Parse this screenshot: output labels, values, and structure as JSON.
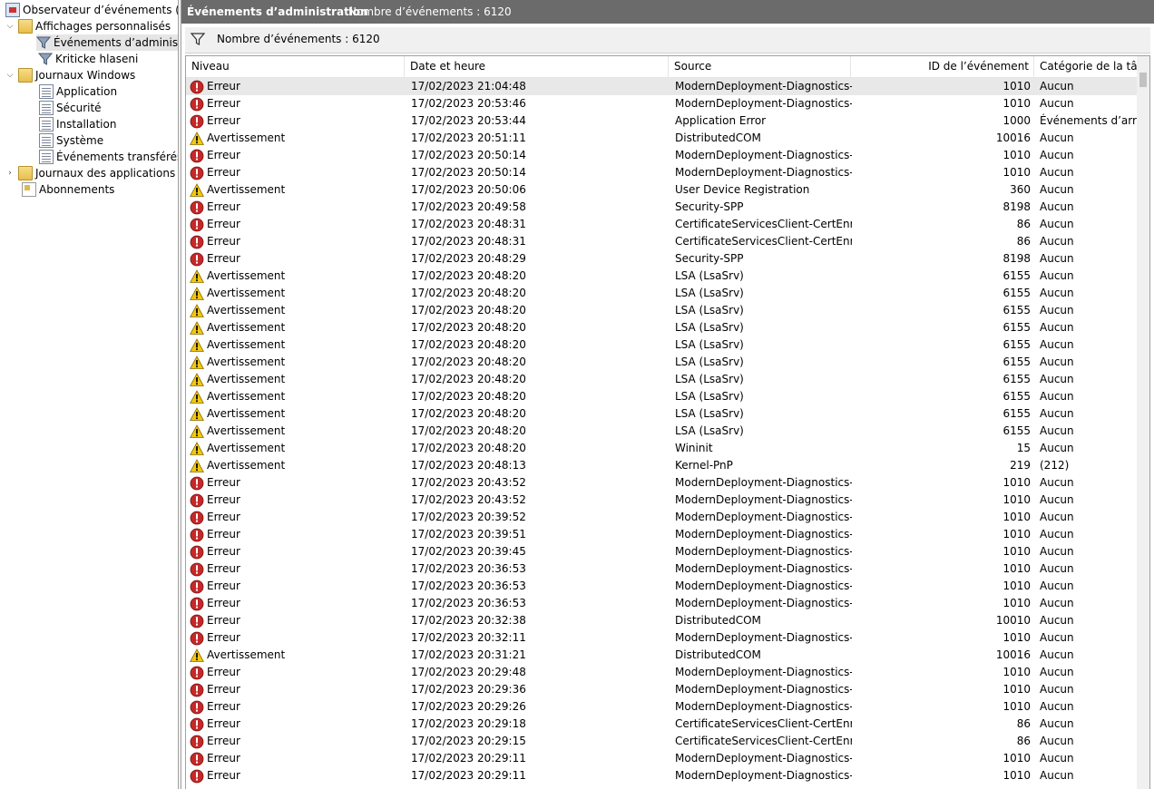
{
  "tree": {
    "root": "Observateur d’événements (Local)",
    "custom_views": "Affichages personnalisés",
    "admin_events": "Événements d’administration",
    "critical_errors": "Kriticke hlaseni",
    "windows_logs": "Journaux Windows",
    "application": "Application",
    "security": "Sécurité",
    "setup": "Installation",
    "system": "Système",
    "forwarded": "Événements transférés",
    "apps_services": "Journaux des applications et des services",
    "subscriptions": "Abonnements"
  },
  "titlebar": {
    "title": "Événements d’administration",
    "count": "Nombre d’événements : 6120"
  },
  "filter": {
    "text": "Nombre d’événements : 6120"
  },
  "columns": {
    "level": "Niveau",
    "datetime": "Date et heure",
    "source": "Source",
    "event_id": "ID de l’événement",
    "category": "Catégorie de la tâche"
  },
  "colors": {
    "error": "#c62828",
    "warning": "#f2c811",
    "titlebar": "#6b6b6b"
  },
  "events": [
    {
      "level": "Erreur",
      "type": "error",
      "datetime": "17/02/2023 21:04:48",
      "source": "ModernDeployment-Diagnostics-...",
      "id": "1010",
      "category": "Aucun"
    },
    {
      "level": "Erreur",
      "type": "error",
      "datetime": "17/02/2023 20:53:46",
      "source": "ModernDeployment-Diagnostics-...",
      "id": "1010",
      "category": "Aucun"
    },
    {
      "level": "Erreur",
      "type": "error",
      "datetime": "17/02/2023 20:53:44",
      "source": "Application Error",
      "id": "1000",
      "category": "Événements d’arrêts"
    },
    {
      "level": "Avertissement",
      "type": "warning",
      "datetime": "17/02/2023 20:51:11",
      "source": "DistributedCOM",
      "id": "10016",
      "category": "Aucun"
    },
    {
      "level": "Erreur",
      "type": "error",
      "datetime": "17/02/2023 20:50:14",
      "source": "ModernDeployment-Diagnostics-...",
      "id": "1010",
      "category": "Aucun"
    },
    {
      "level": "Erreur",
      "type": "error",
      "datetime": "17/02/2023 20:50:14",
      "source": "ModernDeployment-Diagnostics-...",
      "id": "1010",
      "category": "Aucun"
    },
    {
      "level": "Avertissement",
      "type": "warning",
      "datetime": "17/02/2023 20:50:06",
      "source": "User Device Registration",
      "id": "360",
      "category": "Aucun"
    },
    {
      "level": "Erreur",
      "type": "error",
      "datetime": "17/02/2023 20:49:58",
      "source": "Security-SPP",
      "id": "8198",
      "category": "Aucun"
    },
    {
      "level": "Erreur",
      "type": "error",
      "datetime": "17/02/2023 20:48:31",
      "source": "CertificateServicesClient-CertEnroll",
      "id": "86",
      "category": "Aucun"
    },
    {
      "level": "Erreur",
      "type": "error",
      "datetime": "17/02/2023 20:48:31",
      "source": "CertificateServicesClient-CertEnroll",
      "id": "86",
      "category": "Aucun"
    },
    {
      "level": "Erreur",
      "type": "error",
      "datetime": "17/02/2023 20:48:29",
      "source": "Security-SPP",
      "id": "8198",
      "category": "Aucun"
    },
    {
      "level": "Avertissement",
      "type": "warning",
      "datetime": "17/02/2023 20:48:20",
      "source": "LSA (LsaSrv)",
      "id": "6155",
      "category": "Aucun"
    },
    {
      "level": "Avertissement",
      "type": "warning",
      "datetime": "17/02/2023 20:48:20",
      "source": "LSA (LsaSrv)",
      "id": "6155",
      "category": "Aucun"
    },
    {
      "level": "Avertissement",
      "type": "warning",
      "datetime": "17/02/2023 20:48:20",
      "source": "LSA (LsaSrv)",
      "id": "6155",
      "category": "Aucun"
    },
    {
      "level": "Avertissement",
      "type": "warning",
      "datetime": "17/02/2023 20:48:20",
      "source": "LSA (LsaSrv)",
      "id": "6155",
      "category": "Aucun"
    },
    {
      "level": "Avertissement",
      "type": "warning",
      "datetime": "17/02/2023 20:48:20",
      "source": "LSA (LsaSrv)",
      "id": "6155",
      "category": "Aucun"
    },
    {
      "level": "Avertissement",
      "type": "warning",
      "datetime": "17/02/2023 20:48:20",
      "source": "LSA (LsaSrv)",
      "id": "6155",
      "category": "Aucun"
    },
    {
      "level": "Avertissement",
      "type": "warning",
      "datetime": "17/02/2023 20:48:20",
      "source": "LSA (LsaSrv)",
      "id": "6155",
      "category": "Aucun"
    },
    {
      "level": "Avertissement",
      "type": "warning",
      "datetime": "17/02/2023 20:48:20",
      "source": "LSA (LsaSrv)",
      "id": "6155",
      "category": "Aucun"
    },
    {
      "level": "Avertissement",
      "type": "warning",
      "datetime": "17/02/2023 20:48:20",
      "source": "LSA (LsaSrv)",
      "id": "6155",
      "category": "Aucun"
    },
    {
      "level": "Avertissement",
      "type": "warning",
      "datetime": "17/02/2023 20:48:20",
      "source": "LSA (LsaSrv)",
      "id": "6155",
      "category": "Aucun"
    },
    {
      "level": "Avertissement",
      "type": "warning",
      "datetime": "17/02/2023 20:48:20",
      "source": "Wininit",
      "id": "15",
      "category": "Aucun"
    },
    {
      "level": "Avertissement",
      "type": "warning",
      "datetime": "17/02/2023 20:48:13",
      "source": "Kernel-PnP",
      "id": "219",
      "category": "(212)"
    },
    {
      "level": "Erreur",
      "type": "error",
      "datetime": "17/02/2023 20:43:52",
      "source": "ModernDeployment-Diagnostics-...",
      "id": "1010",
      "category": "Aucun"
    },
    {
      "level": "Erreur",
      "type": "error",
      "datetime": "17/02/2023 20:43:52",
      "source": "ModernDeployment-Diagnostics-...",
      "id": "1010",
      "category": "Aucun"
    },
    {
      "level": "Erreur",
      "type": "error",
      "datetime": "17/02/2023 20:39:52",
      "source": "ModernDeployment-Diagnostics-...",
      "id": "1010",
      "category": "Aucun"
    },
    {
      "level": "Erreur",
      "type": "error",
      "datetime": "17/02/2023 20:39:51",
      "source": "ModernDeployment-Diagnostics-...",
      "id": "1010",
      "category": "Aucun"
    },
    {
      "level": "Erreur",
      "type": "error",
      "datetime": "17/02/2023 20:39:45",
      "source": "ModernDeployment-Diagnostics-...",
      "id": "1010",
      "category": "Aucun"
    },
    {
      "level": "Erreur",
      "type": "error",
      "datetime": "17/02/2023 20:36:53",
      "source": "ModernDeployment-Diagnostics-...",
      "id": "1010",
      "category": "Aucun"
    },
    {
      "level": "Erreur",
      "type": "error",
      "datetime": "17/02/2023 20:36:53",
      "source": "ModernDeployment-Diagnostics-...",
      "id": "1010",
      "category": "Aucun"
    },
    {
      "level": "Erreur",
      "type": "error",
      "datetime": "17/02/2023 20:36:53",
      "source": "ModernDeployment-Diagnostics-...",
      "id": "1010",
      "category": "Aucun"
    },
    {
      "level": "Erreur",
      "type": "error",
      "datetime": "17/02/2023 20:32:38",
      "source": "DistributedCOM",
      "id": "10010",
      "category": "Aucun"
    },
    {
      "level": "Erreur",
      "type": "error",
      "datetime": "17/02/2023 20:32:11",
      "source": "ModernDeployment-Diagnostics-...",
      "id": "1010",
      "category": "Aucun"
    },
    {
      "level": "Avertissement",
      "type": "warning",
      "datetime": "17/02/2023 20:31:21",
      "source": "DistributedCOM",
      "id": "10016",
      "category": "Aucun"
    },
    {
      "level": "Erreur",
      "type": "error",
      "datetime": "17/02/2023 20:29:48",
      "source": "ModernDeployment-Diagnostics-...",
      "id": "1010",
      "category": "Aucun"
    },
    {
      "level": "Erreur",
      "type": "error",
      "datetime": "17/02/2023 20:29:36",
      "source": "ModernDeployment-Diagnostics-...",
      "id": "1010",
      "category": "Aucun"
    },
    {
      "level": "Erreur",
      "type": "error",
      "datetime": "17/02/2023 20:29:26",
      "source": "ModernDeployment-Diagnostics-...",
      "id": "1010",
      "category": "Aucun"
    },
    {
      "level": "Erreur",
      "type": "error",
      "datetime": "17/02/2023 20:29:18",
      "source": "CertificateServicesClient-CertEnroll",
      "id": "86",
      "category": "Aucun"
    },
    {
      "level": "Erreur",
      "type": "error",
      "datetime": "17/02/2023 20:29:15",
      "source": "CertificateServicesClient-CertEnroll",
      "id": "86",
      "category": "Aucun"
    },
    {
      "level": "Erreur",
      "type": "error",
      "datetime": "17/02/2023 20:29:11",
      "source": "ModernDeployment-Diagnostics-...",
      "id": "1010",
      "category": "Aucun"
    },
    {
      "level": "Erreur",
      "type": "error",
      "datetime": "17/02/2023 20:29:11",
      "source": "ModernDeployment-Diagnostics-...",
      "id": "1010",
      "category": "Aucun"
    }
  ]
}
